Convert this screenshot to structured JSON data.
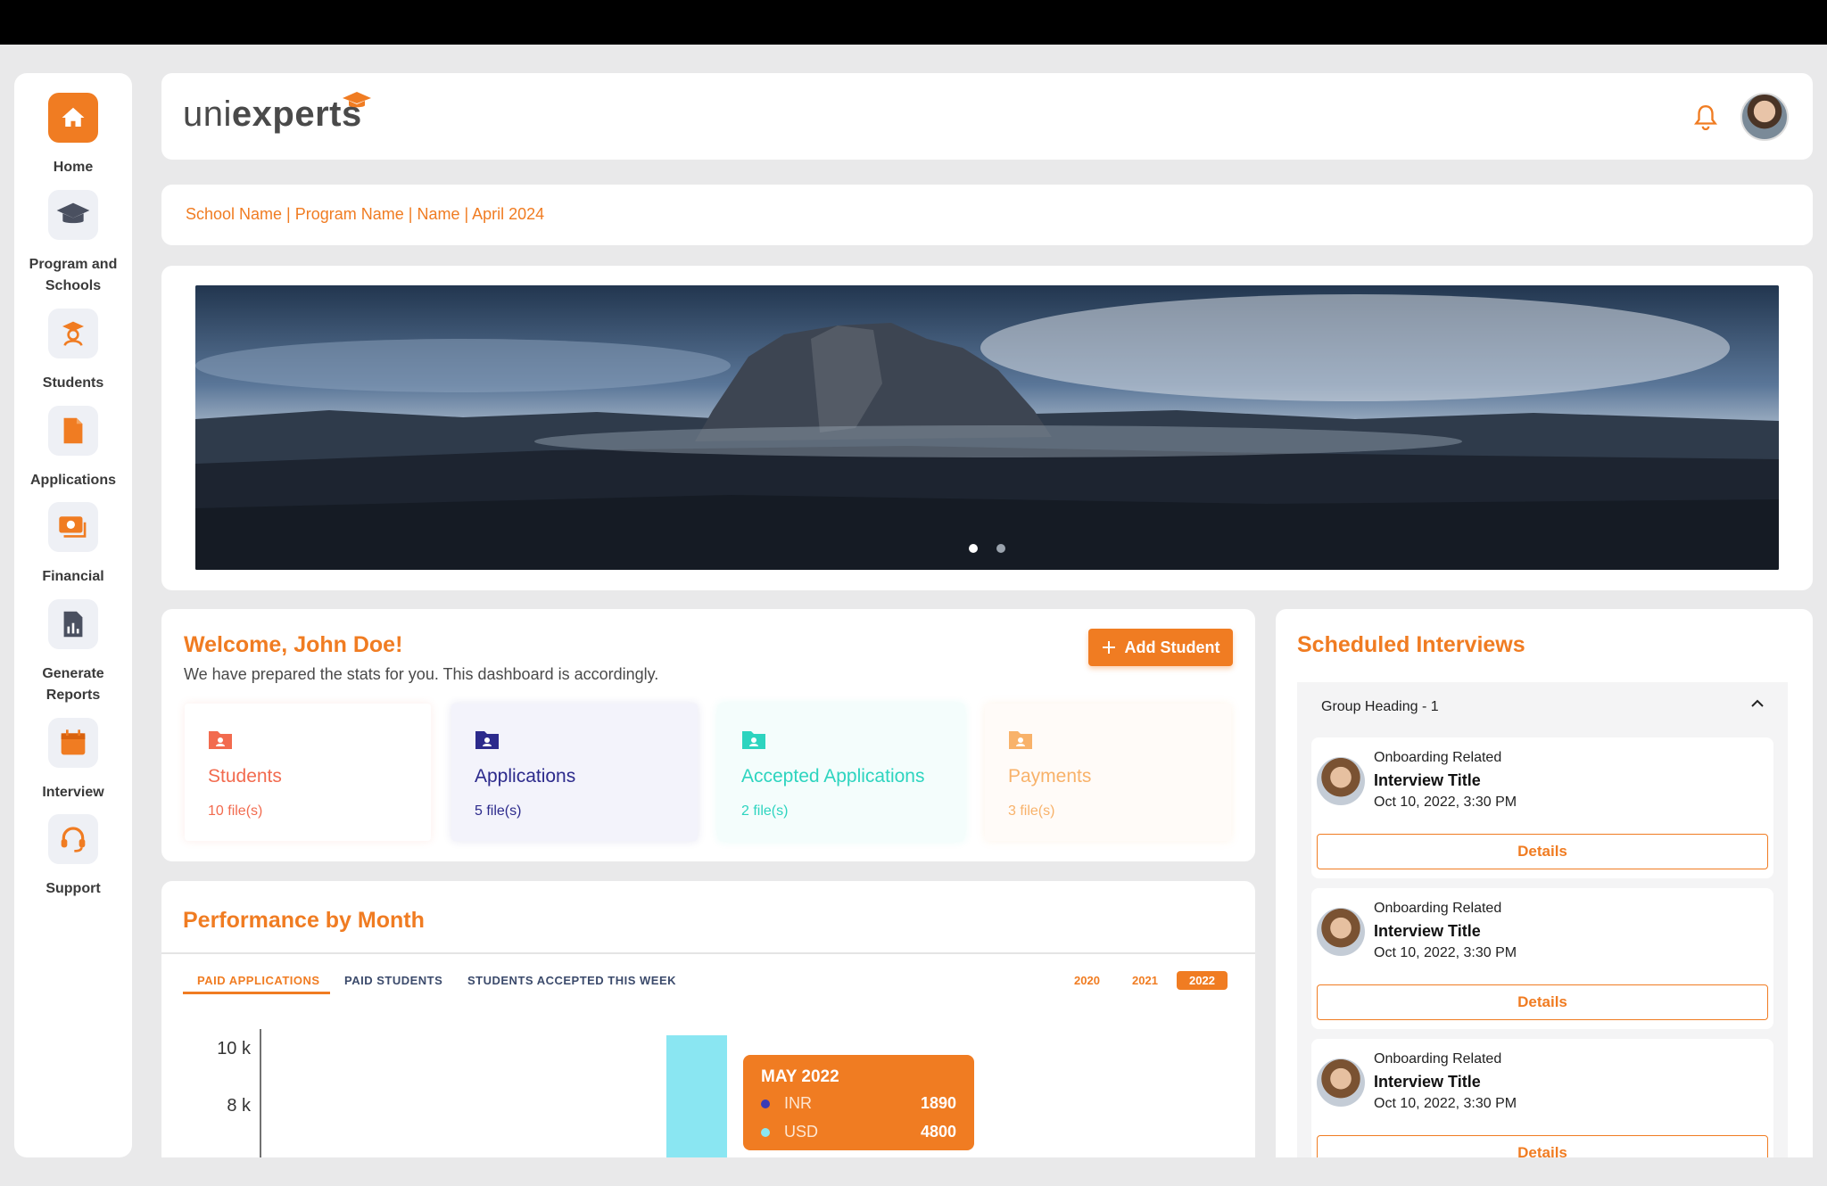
{
  "app": {
    "logo_prefix": "uni",
    "logo_suffix": "experts"
  },
  "sidebar": {
    "items": [
      {
        "label": "Home",
        "icon": "home-icon"
      },
      {
        "label": "Program and Schools",
        "icon": "graduation-cap-icon"
      },
      {
        "label": "Students",
        "icon": "student-icon"
      },
      {
        "label": "Applications",
        "icon": "document-icon"
      },
      {
        "label": "Financial",
        "icon": "money-icon"
      },
      {
        "label": "Generate Reports",
        "icon": "report-icon"
      },
      {
        "label": "Interview",
        "icon": "calendar-icon"
      },
      {
        "label": "Support",
        "icon": "headset-icon"
      }
    ]
  },
  "breadcrumb": "School Name | Program Name | Name | April 2024",
  "welcome": {
    "title": "Welcome, John Doe!",
    "subtitle": "We have prepared the stats for you. This dashboard is accordingly.",
    "add_button": "Add Student",
    "stats": [
      {
        "title": "Students",
        "sub": "10 file(s)",
        "color": "#f26b4f"
      },
      {
        "title": "Applications",
        "sub": "5 file(s)",
        "color": "#2c2a8c"
      },
      {
        "title": "Accepted Applications",
        "sub": "2 file(s)",
        "color": "#2dd4bf"
      },
      {
        "title": "Payments",
        "sub": "3 file(s)",
        "color": "#f8b26a"
      }
    ]
  },
  "performance": {
    "title": "Performance by Month",
    "tabs": [
      "PAID APPLICATIONS",
      "PAID STUDENTS",
      "STUDENTS ACCEPTED THIS WEEK"
    ],
    "years": [
      "2020",
      "2021",
      "2022"
    ],
    "active_year": "2022"
  },
  "chart_data": {
    "type": "bar",
    "yticks": [
      "10 k",
      "8 k"
    ],
    "ylim": [
      0,
      10000
    ],
    "categories": [
      "MAY 2022"
    ],
    "series": [
      {
        "name": "INR",
        "values": [
          1890
        ],
        "color": "#3b3bb5"
      },
      {
        "name": "USD",
        "values": [
          4800
        ],
        "color": "#8ae6f2"
      }
    ],
    "tooltip": {
      "title": "MAY 2022",
      "rows": [
        {
          "label": "INR",
          "value": "1890"
        },
        {
          "label": "USD",
          "value": "4800"
        }
      ]
    }
  },
  "interviews": {
    "title": "Scheduled Interviews",
    "group_heading": "Group Heading - 1",
    "items": [
      {
        "category": "Onboarding Related",
        "title": "Interview Title",
        "date": "Oct 10, 2022, 3:30 PM",
        "action": "Details"
      },
      {
        "category": "Onboarding Related",
        "title": "Interview Title",
        "date": "Oct 10, 2022, 3:30 PM",
        "action": "Details"
      },
      {
        "category": "Onboarding Related",
        "title": "Interview Title",
        "date": "Oct 10, 2022, 3:30 PM",
        "action": "Details"
      }
    ]
  },
  "colors": {
    "accent": "#f07c22",
    "background": "#e9e9ea"
  }
}
